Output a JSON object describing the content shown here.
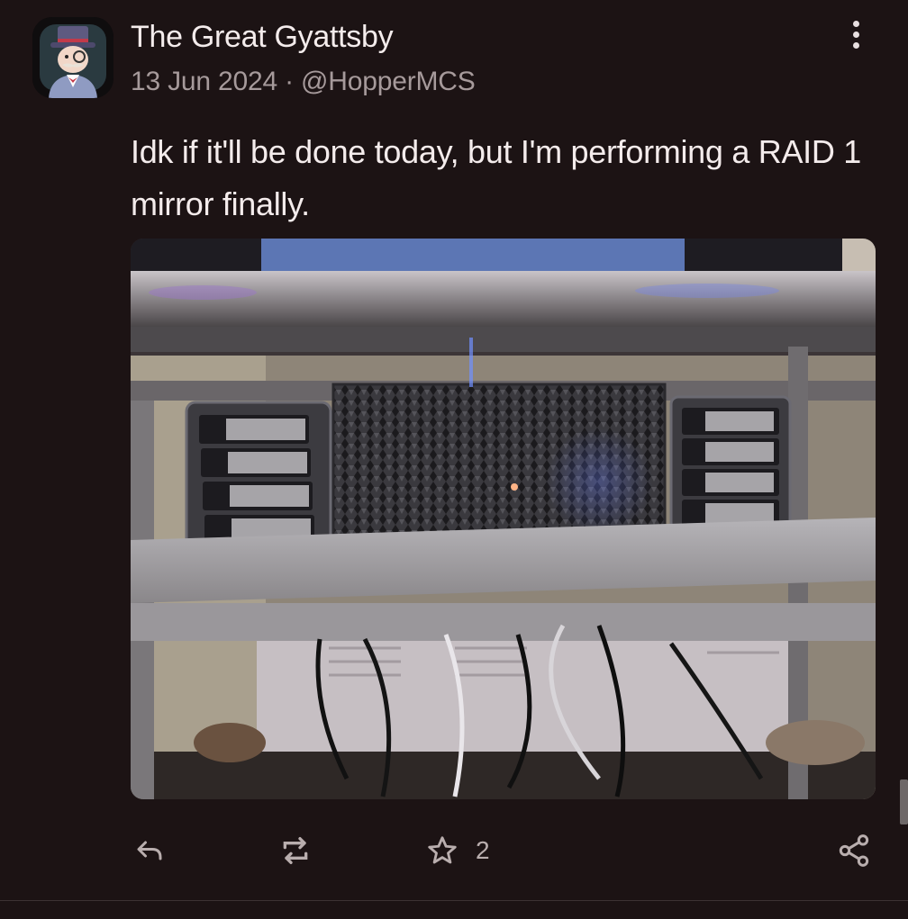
{
  "post": {
    "author": {
      "display_name": "The Great Gyattsby",
      "avatar_icon": "top-hat-gentleman-avatar"
    },
    "date": "13 Jun 2024",
    "separator": "·",
    "handle": "@HopperMCS",
    "text": "Idk if it'll be done today, but I'm performing a RAID 1 mirror finally.",
    "media": {
      "description_icon": "photo",
      "scene": "drive-enclosures-on-shelf"
    },
    "actions": {
      "reply_icon": "reply-icon",
      "boost_icon": "repeat-icon",
      "favourite_icon": "star-icon",
      "favourite_count": "2",
      "share_icon": "share-icon",
      "more_icon": "more-vertical-icon"
    }
  },
  "colors": {
    "background": "#1c1314",
    "text_primary": "#f4ecec",
    "text_secondary": "#a69a9b",
    "icon": "#b9aeae"
  }
}
